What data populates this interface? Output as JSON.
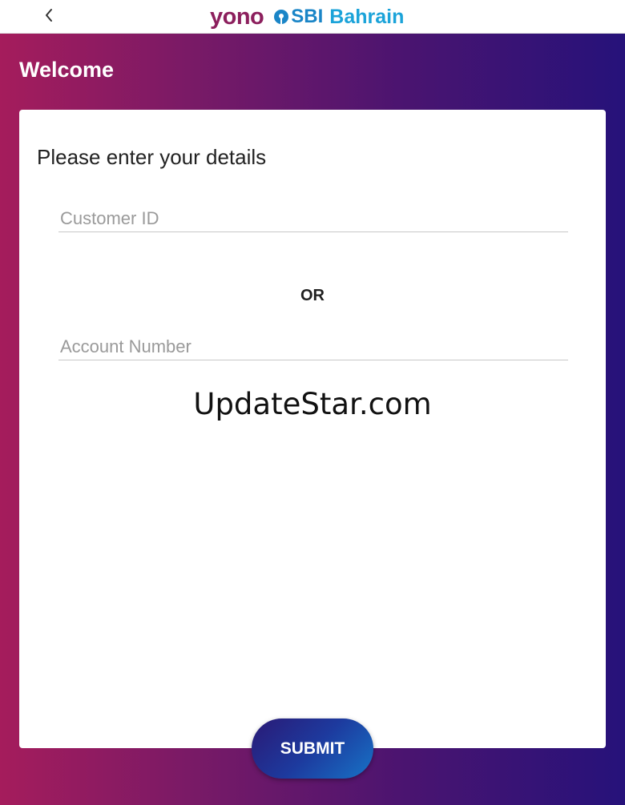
{
  "header": {
    "logo_yono": "yono",
    "logo_sbi": "SBI",
    "logo_bahrain": "Bahrain",
    "back_icon": "chevron-left-icon"
  },
  "page": {
    "title": "Welcome"
  },
  "form": {
    "heading": "Please enter your details",
    "customer_id_placeholder": "Customer ID",
    "customer_id_value": "",
    "or_label": "OR",
    "account_number_placeholder": "Account Number",
    "account_number_value": "",
    "submit_label": "SUBMIT"
  },
  "watermark": "UpdateStar.com",
  "colors": {
    "gradient_left": "#a51c5c",
    "gradient_right": "#26127a",
    "yono": "#8c1f5d",
    "sbi_blue": "#1a85c7",
    "submit_gradient_start": "#2a1975",
    "submit_gradient_end": "#1773c6"
  }
}
